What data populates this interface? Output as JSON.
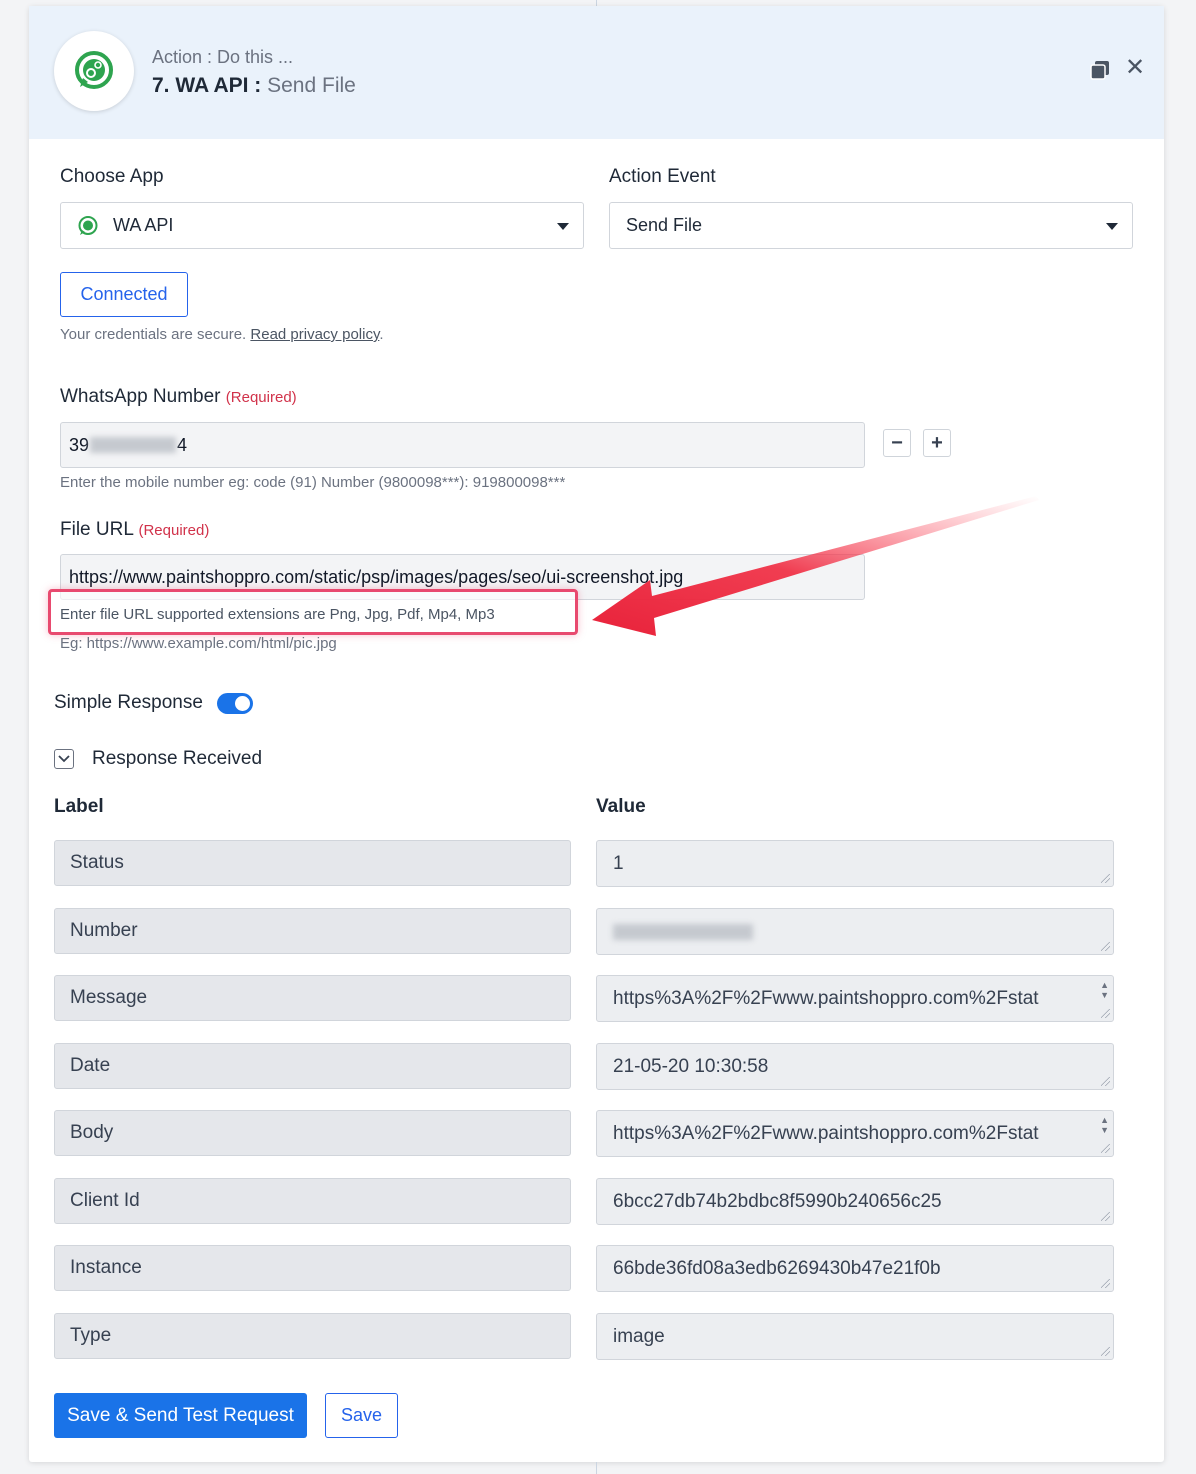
{
  "header": {
    "subtitle": "Action : Do this ...",
    "step_title": "7. WA API : ",
    "step_event": "Send File"
  },
  "choose_app": {
    "label": "Choose App",
    "value": "WA API"
  },
  "action_event": {
    "label": "Action Event",
    "value": "Send File"
  },
  "connection": {
    "button_label": "Connected",
    "secure_text": "Your credentials are secure. ",
    "privacy_link": "Read privacy policy",
    "period": "."
  },
  "whatsapp": {
    "label": "WhatsApp Number",
    "required": "(Required)",
    "value_prefix": "39",
    "value_suffix": "4",
    "help": "Enter the mobile number eg: code (91) Number (9800098***): 919800098***",
    "minus": "−",
    "plus": "+"
  },
  "file_url": {
    "label": "File URL",
    "required": "(Required)",
    "value": "https://www.paintshoppro.com/static/psp/images/pages/seo/ui-screenshot.jpg",
    "help": "Enter file URL supported extensions are Png, Jpg, Pdf, Mp4, Mp3",
    "example": "Eg: https://www.example.com/html/pic.jpg"
  },
  "simple_response": {
    "label": "Simple Response",
    "enabled": true
  },
  "response": {
    "title": "Response Received",
    "col_label": "Label",
    "col_value": "Value",
    "rows": [
      {
        "label": "Status",
        "value": "1"
      },
      {
        "label": "Number",
        "value": ""
      },
      {
        "label": "Message",
        "value": "https%3A%2F%2Fwww.paintshoppro.com%2Fstat"
      },
      {
        "label": "Date",
        "value": "21-05-20 10:30:58"
      },
      {
        "label": "Body",
        "value": "https%3A%2F%2Fwww.paintshoppro.com%2Fstat"
      },
      {
        "label": "Client Id",
        "value": "6bcc27db74b2bdbc8f5990b240656c25"
      },
      {
        "label": "Instance",
        "value": "66bde36fd08a3edb6269430b47e21f0b"
      },
      {
        "label": "Type",
        "value": "image"
      }
    ]
  },
  "actions": {
    "save_send": "Save & Send Test Request",
    "save": "Save"
  },
  "colors": {
    "accent": "#1a73e8",
    "header_bg": "#eaf2fb",
    "required": "#d1324a",
    "annotation": "#e8223a"
  }
}
